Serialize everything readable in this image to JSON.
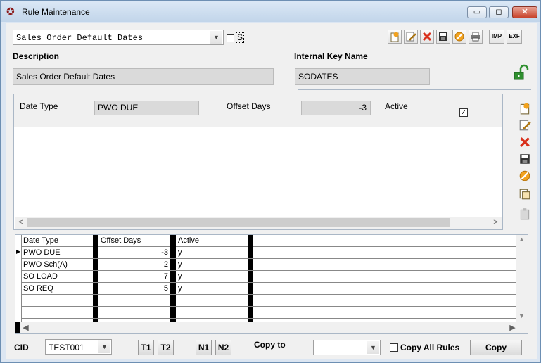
{
  "window": {
    "title": "Rule Maintenance",
    "min_label": "▭",
    "max_label": "◻",
    "close_label": "✕"
  },
  "top": {
    "rule_select_value": "Sales Order Default Dates",
    "s_label": "S",
    "toolbar": {
      "imp_label": "IMP",
      "exp_label": "EXF"
    }
  },
  "header": {
    "description_label": "Description",
    "description_value": "Sales Order Default Dates",
    "key_label": "Internal Key Name",
    "key_value": "SODATES"
  },
  "detail": {
    "date_type_label": "Date Type",
    "date_type_value": "PWO DUE",
    "offset_label": "Offset Days",
    "offset_value": "-3",
    "active_label": "Active",
    "active_checked": true
  },
  "grid": {
    "columns": [
      "Date Type",
      "Offset Days",
      "Active"
    ],
    "rows": [
      {
        "date_type": "PWO DUE",
        "offset": "-3",
        "active": "y"
      },
      {
        "date_type": "PWO Sch(A)",
        "offset": "2",
        "active": "y"
      },
      {
        "date_type": "SO LOAD",
        "offset": "7",
        "active": "y"
      },
      {
        "date_type": "SO REQ",
        "offset": "5",
        "active": "y"
      }
    ]
  },
  "bottom": {
    "cid_label": "CID",
    "cid_value": "TEST001",
    "t1_label": "T1",
    "t2_label": "T2",
    "n1_label": "N1",
    "n2_label": "N2",
    "copy_to_label": "Copy to",
    "copy_to_value": "",
    "copy_all_label": "Copy All Rules",
    "copy_button_label": "Copy"
  },
  "colors": {
    "accent_red": "#d9301c",
    "accent_orange": "#f2a21e",
    "lock_green": "#2f8f2f"
  }
}
